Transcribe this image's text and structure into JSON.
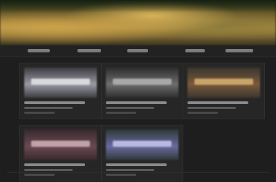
{
  "header": {
    "title": ""
  },
  "nav": {
    "tabs": [
      {
        "label": ""
      },
      {
        "label": ""
      },
      {
        "label": ""
      },
      {
        "label": ""
      },
      {
        "label": ""
      }
    ]
  },
  "cards": [
    {
      "title": "",
      "thumb_colors": [
        "#3b3b3f",
        "#9a9aa6",
        "#d9d9dd"
      ]
    },
    {
      "title": "",
      "thumb_colors": [
        "#2d2d2d",
        "#6e6e6e",
        "#a9a9a9"
      ]
    },
    {
      "title": "",
      "thumb_colors": [
        "#3a3530",
        "#7a5a3a",
        "#c9a46a"
      ]
    },
    {
      "title": "",
      "thumb_colors": [
        "#3a2a2e",
        "#6a4a52",
        "#c0a2a8"
      ]
    },
    {
      "title": "",
      "thumb_colors": [
        "#2f3a3a",
        "#6a6aa0",
        "#b8b8e0"
      ]
    }
  ]
}
